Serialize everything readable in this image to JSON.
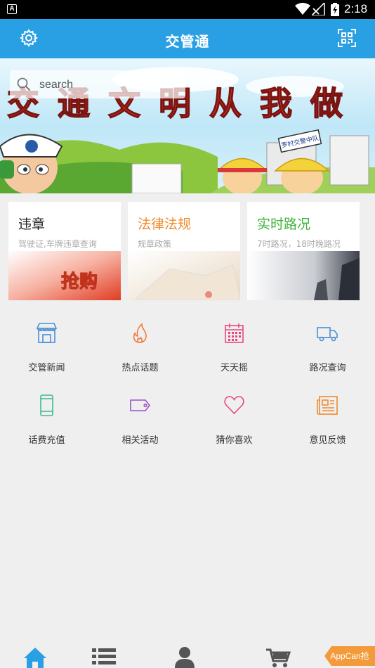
{
  "status_bar": {
    "time": "2:18"
  },
  "header": {
    "title": "交管通",
    "left_icon": "gear-icon",
    "right_icon": "qr-scan-icon"
  },
  "banner": {
    "slogan": "交通文明从我做",
    "sign_text": "罗村交警中队"
  },
  "search": {
    "placeholder": "search"
  },
  "cards": [
    {
      "title": "违章",
      "subtitle": "驾驶证,车牌违章查询",
      "title_color": "#222222",
      "image_text": "抢购"
    },
    {
      "title": "法律法规",
      "subtitle": "规章政策",
      "title_color": "#f08a2c"
    },
    {
      "title": "实时路况",
      "subtitle": "7时路况，18时晚路况",
      "title_color": "#3fb13a"
    }
  ],
  "grid": [
    {
      "label": "交管新闻",
      "icon": "store-icon",
      "color": "#4a8fd6"
    },
    {
      "label": "热点话题",
      "icon": "flame-icon",
      "color": "#f07b3a"
    },
    {
      "label": "天天摇",
      "icon": "calendar-icon",
      "color": "#e8477c"
    },
    {
      "label": "路况查询",
      "icon": "truck-icon",
      "color": "#4a8fd6"
    },
    {
      "label": "话费充值",
      "icon": "phone-icon",
      "color": "#3dbb8c"
    },
    {
      "label": "相关活动",
      "icon": "tag-icon",
      "color": "#9b54c9"
    },
    {
      "label": "猜你喜欢",
      "icon": "heart-icon",
      "color": "#e8477c"
    },
    {
      "label": "意见反馈",
      "icon": "newspaper-icon",
      "color": "#f08a2c"
    }
  ],
  "bottom_nav": [
    {
      "icon": "home-icon",
      "active": true
    },
    {
      "icon": "list-icon",
      "active": false
    },
    {
      "icon": "user-icon",
      "active": false
    },
    {
      "icon": "cart-icon",
      "active": false
    }
  ],
  "appcan_badge": "AppCan抢",
  "colors": {
    "primary": "#2aa0e4",
    "background": "#efefef",
    "nav_active": "#2aa0e4",
    "nav_inactive": "#555555"
  }
}
